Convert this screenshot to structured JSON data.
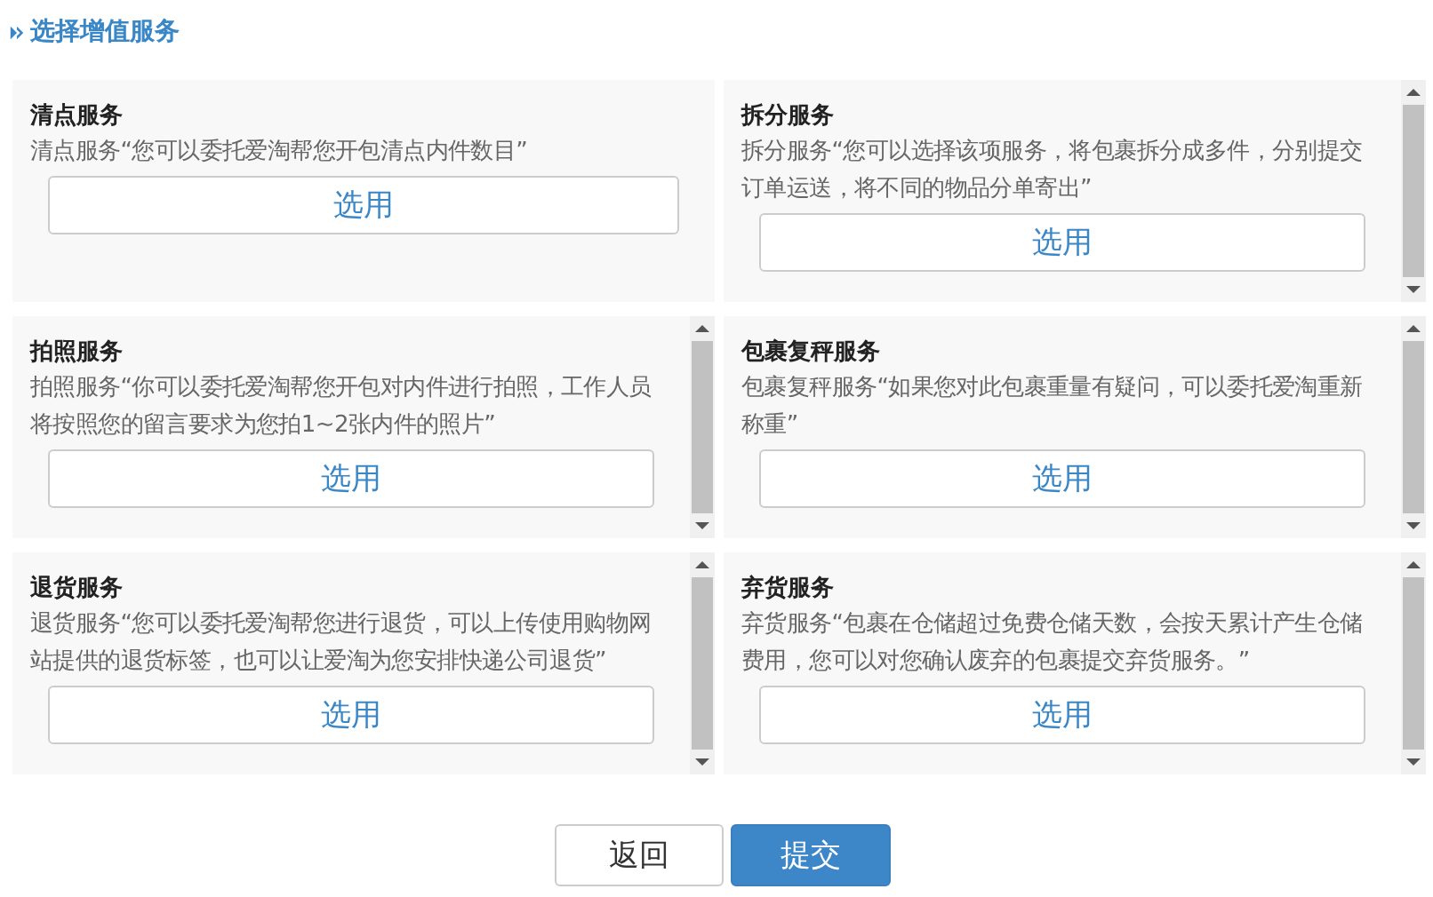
{
  "heading": "选择增值服务",
  "services": [
    {
      "title": "清点服务",
      "description": "清点服务“您可以委托爱淘帮您开包清点内件数目”",
      "button": "选用",
      "scrollbar": false
    },
    {
      "title": "拆分服务",
      "description": "拆分服务“您可以选择该项服务，将包裹拆分成多件，分别提交订单运送，将不同的物品分单寄出”",
      "button": "选用",
      "scrollbar": true
    },
    {
      "title": "拍照服务",
      "description": "拍照服务“你可以委托爱淘帮您开包对内件进行拍照，工作人员将按照您的留言要求为您拍1~2张内件的照片”",
      "button": "选用",
      "scrollbar": true
    },
    {
      "title": "包裹复秤服务",
      "description": "包裹复秤服务“如果您对此包裹重量有疑问，可以委托爱淘重新称重”",
      "button": "选用",
      "scrollbar": true
    },
    {
      "title": "退货服务",
      "description": "退货服务“您可以委托爱淘帮您进行退货，可以上传使用购物网站提供的退货标签，也可以让爱淘为您安排快递公司退货”",
      "button": "选用",
      "scrollbar": true
    },
    {
      "title": "弃货服务",
      "description": "弃货服务“包裹在仓储超过免费仓储天数，会按天累计产生仓储费用，您可以对您确认废弃的包裹提交弃货服务。”",
      "button": "选用",
      "scrollbar": true
    }
  ],
  "actions": [
    {
      "label": "返回",
      "kind": "secondary"
    },
    {
      "label": "提交",
      "kind": "primary"
    }
  ]
}
